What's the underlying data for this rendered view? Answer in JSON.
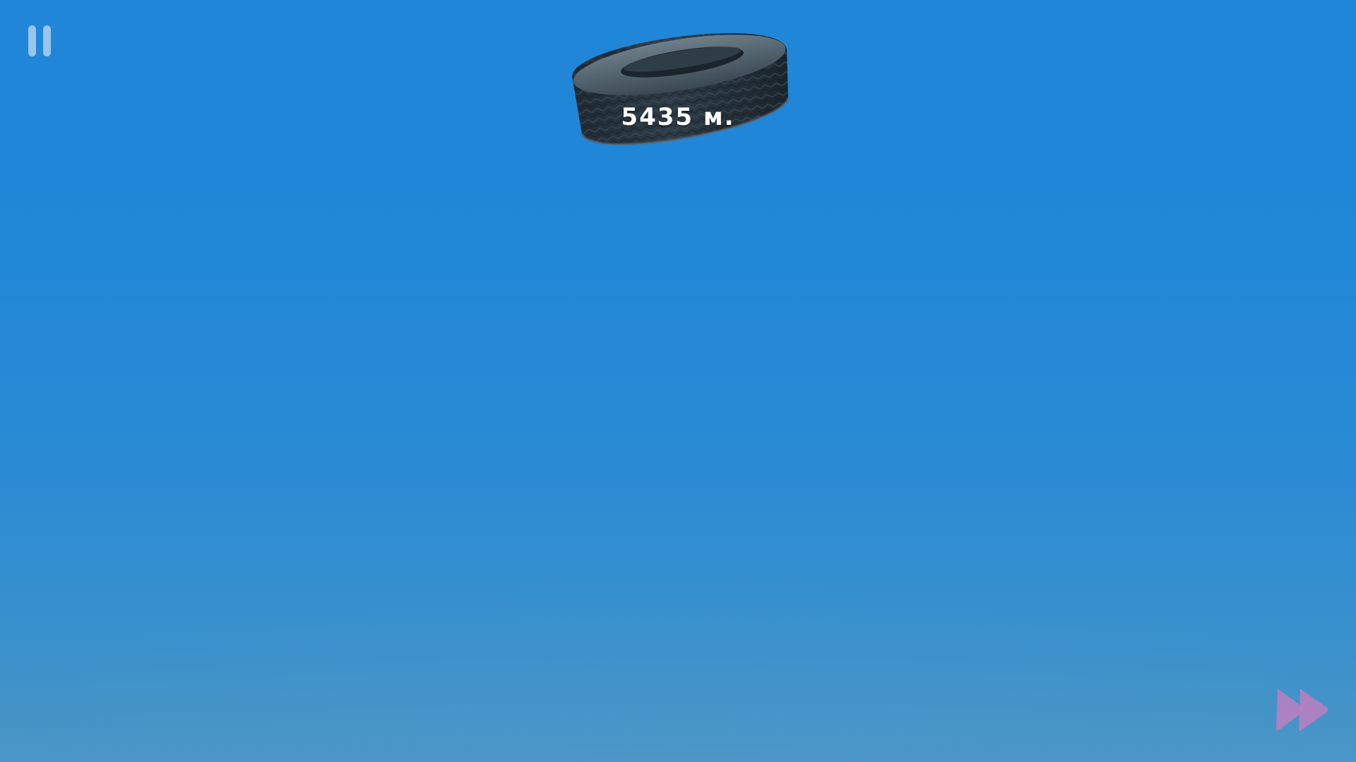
{
  "hud": {
    "pause_icon": "pause-icon",
    "distance_text": "5435 м.",
    "skip_icon": "fast-forward-icon",
    "skip_color": "#b77fbf"
  },
  "scene": {
    "object": "tire",
    "sky_top_color": "#1f86d8",
    "sky_bottom_color": "#4a96c4"
  }
}
